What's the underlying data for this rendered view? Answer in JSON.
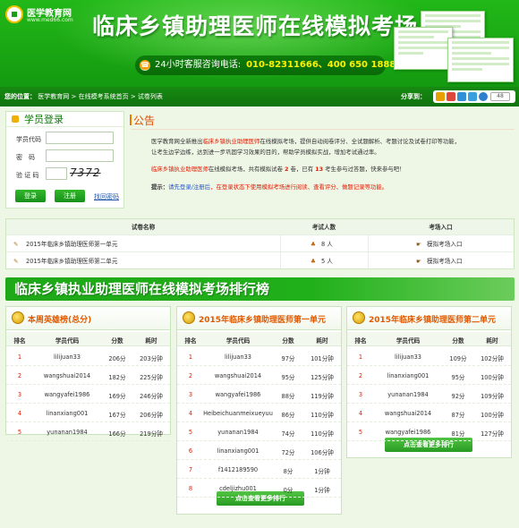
{
  "header": {
    "logo_name": "医学教育网",
    "logo_url": "www.med66.com",
    "title": "临床乡镇助理医师在线模拟考场",
    "hotline_label": "24小时客服咨询电话:",
    "hotline_numbers": "010-82311666、400 650 1888"
  },
  "nav": {
    "prefix": "您的位置：",
    "crumbs": [
      "医学教育网",
      "在线模考系统首页",
      "试卷列表"
    ],
    "sep": ">",
    "share_label": "分享到：",
    "share_count": "48"
  },
  "login": {
    "title": "学员登录",
    "fields": [
      {
        "label": "学员代码",
        "value": ""
      },
      {
        "label": "密　码",
        "value": ""
      },
      {
        "label": "验 证 码",
        "value": ""
      }
    ],
    "captcha": "7372",
    "login_btn": "登录",
    "register_btn": "注册",
    "forgot": "找回密码"
  },
  "notice": {
    "title": "公告",
    "p1a": "医学教育网全新推出",
    "p1b": "临床乡镇执业助理医师",
    "p1c": "在线模拟考场，提供自动阅卷评分、全试题解析、考题讨论及试卷打印等功能，",
    "p1d": "让考生边学边练，达到进一步巩固学习效果的目的，帮助学员模拟实战，增加考试通过率。",
    "p2a": "临床乡镇执业助理医师",
    "p2b": "在线模拟考场，共有模拟试卷",
    "p2c": "2",
    "p2d": "卷，已有",
    "p2e": "13",
    "p2f": "考生参与过答题，快来参与吧！",
    "tip_label": "提示：",
    "tip_link": "请先登录/注册后",
    "tip_text": "，在登录状态下使用模拟考场进行阅读、查看评分、做题记录等功能。"
  },
  "exam_table": {
    "headers": [
      "试卷名称",
      "考试人数",
      "考场入口"
    ],
    "rows": [
      {
        "name": "2015年临床乡镇助理医师第一单元",
        "count": "8 人",
        "entry": "模拟考场入口"
      },
      {
        "name": "2015年临床乡镇助理医师第二单元",
        "count": "5 人",
        "entry": "模拟考场入口"
      }
    ]
  },
  "rank_title": "临床乡镇执业助理医师在线模拟考场排行榜",
  "rank_headers": [
    "排名",
    "学员代码",
    "分数",
    "耗时"
  ],
  "more_label": "点击查看更多排行",
  "panels": [
    {
      "title": "本周英雄榜(总分)",
      "rows": [
        {
          "rank": "1",
          "user": "lilijuan33",
          "score": "206分",
          "time": "203分钟"
        },
        {
          "rank": "2",
          "user": "wangshuai2014",
          "score": "182分",
          "time": "225分钟"
        },
        {
          "rank": "3",
          "user": "wangyafei1986",
          "score": "169分",
          "time": "246分钟"
        },
        {
          "rank": "4",
          "user": "linanxiang001",
          "score": "167分",
          "time": "206分钟"
        },
        {
          "rank": "5",
          "user": "yunanan1984",
          "score": "166分",
          "time": "219分钟"
        }
      ]
    },
    {
      "title": "2015年临床乡镇助理医师第一单元",
      "rows": [
        {
          "rank": "1",
          "user": "lilijuan33",
          "score": "97分",
          "time": "101分钟"
        },
        {
          "rank": "2",
          "user": "wangshuai2014",
          "score": "95分",
          "time": "125分钟"
        },
        {
          "rank": "3",
          "user": "wangyafei1986",
          "score": "88分",
          "time": "119分钟"
        },
        {
          "rank": "4",
          "user": "Heibeichuanmeixueyuu",
          "score": "86分",
          "time": "110分钟"
        },
        {
          "rank": "5",
          "user": "yunanan1984",
          "score": "74分",
          "time": "110分钟"
        },
        {
          "rank": "6",
          "user": "linanxiang001",
          "score": "72分",
          "time": "106分钟"
        },
        {
          "rank": "7",
          "user": "f1412189590",
          "score": "8分",
          "time": "1分钟"
        },
        {
          "rank": "8",
          "user": "cdeljizhu001",
          "score": "0分",
          "time": "1分钟"
        }
      ]
    },
    {
      "title": "2015年临床乡镇助理医师第二单元",
      "rows": [
        {
          "rank": "1",
          "user": "lilijuan33",
          "score": "109分",
          "time": "102分钟"
        },
        {
          "rank": "2",
          "user": "linanxiang001",
          "score": "95分",
          "time": "100分钟"
        },
        {
          "rank": "3",
          "user": "yunanan1984",
          "score": "92分",
          "time": "109分钟"
        },
        {
          "rank": "4",
          "user": "wangshuai2014",
          "score": "87分",
          "time": "100分钟"
        },
        {
          "rank": "5",
          "user": "wangyafei1986",
          "score": "81分",
          "time": "127分钟"
        }
      ]
    }
  ]
}
